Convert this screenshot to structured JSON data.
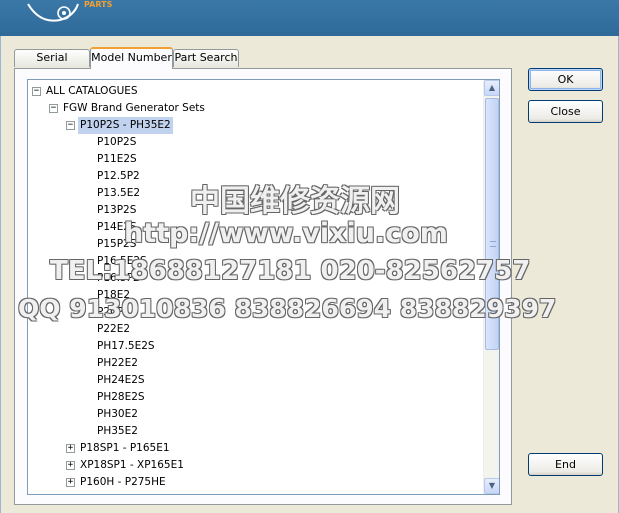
{
  "title_bar": {
    "logo_text": "PARTS"
  },
  "tabs": [
    {
      "label": "Serial Number",
      "active": false
    },
    {
      "label": "Model Number",
      "active": true
    },
    {
      "label": "Part Search",
      "active": false
    }
  ],
  "tree": {
    "root": "ALL CATALOGUES",
    "brand": "FGW Brand Generator Sets",
    "selected_group": "P10P2S - PH35E2",
    "children": [
      "P10P2S",
      "P11E2S",
      "P12.5P2",
      "P13.5E2",
      "P13P2S",
      "P14E2S",
      "P15P2S",
      "P16.5E2S",
      "P16.5P2",
      "P18E2",
      "P20P2",
      "P22E2",
      "PH17.5E2S",
      "PH22E2",
      "PH24E2S",
      "PH28E2S",
      "PH30E2",
      "PH35E2"
    ],
    "collapsed_groups": [
      "P18SP1 - P165E1",
      "XP18SP1 - XP165E1",
      "P160H - P275HE"
    ]
  },
  "buttons": {
    "ok": "OK",
    "close": "Close",
    "end": "End"
  },
  "watermark": {
    "line1": "中国维修资源网",
    "line2": "http://www.vixiu.com",
    "line3": "TEL:18688127181 020-82562757",
    "line4": "QQ 913010836 838826694 838829397"
  },
  "icons": {
    "expanded": "minus-box",
    "collapsed": "plus-box",
    "scroll_up": "▲",
    "scroll_down": "▼"
  }
}
